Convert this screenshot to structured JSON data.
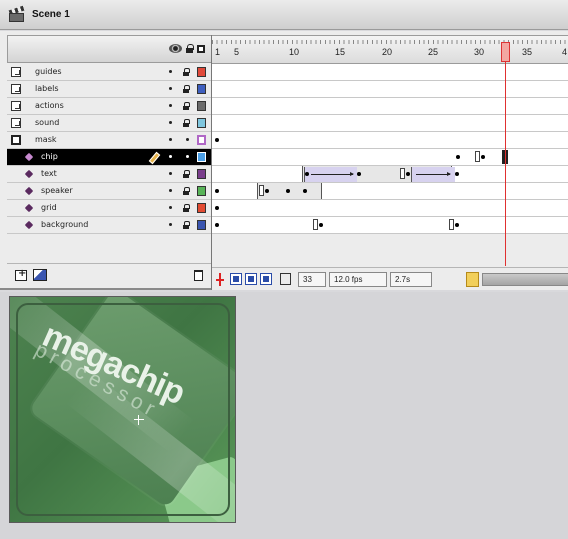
{
  "scene": {
    "label": "Scene 1"
  },
  "ruler": {
    "numbers": [
      "1",
      "5",
      "10",
      "15",
      "20",
      "25",
      "30",
      "35",
      "4"
    ]
  },
  "layers": [
    {
      "name": "guides",
      "type": "folder",
      "swatch": "#e0493a"
    },
    {
      "name": "labels",
      "type": "folder",
      "swatch": "#3f5fbf"
    },
    {
      "name": "actions",
      "type": "folder",
      "swatch": "#6a6a6a"
    },
    {
      "name": "sound",
      "type": "folder",
      "swatch": "#7fc6de"
    },
    {
      "name": "mask",
      "type": "mask",
      "swatch": "#b067c6"
    },
    {
      "name": "chip",
      "type": "masked",
      "swatch": "#4a9fe6",
      "selected": true
    },
    {
      "name": "text",
      "type": "masked",
      "swatch": "#7a3e8c"
    },
    {
      "name": "speaker",
      "type": "masked",
      "swatch": "#58b358"
    },
    {
      "name": "grid",
      "type": "masked",
      "swatch": "#e24b32"
    },
    {
      "name": "background",
      "type": "masked",
      "swatch": "#3a55b0"
    }
  ],
  "status": {
    "frame": "33",
    "fps": "12.0 fps",
    "time": "2.7s"
  },
  "stage": {
    "title": "megachip",
    "subtitle": "processor"
  },
  "colors": {
    "playhead": "#e03030",
    "stage_green": "#4e8350",
    "selected_row": "#000000"
  },
  "icons": [
    "scene-icon",
    "eye-icon",
    "lock-icon",
    "outline-icon",
    "pencil-icon",
    "add-layer-icon",
    "add-guide-layer-icon",
    "trash-icon",
    "center-frame-icon",
    "onion-skin-icon",
    "onion-outline-icon",
    "edit-multiple-icon",
    "modify-markers-icon"
  ]
}
